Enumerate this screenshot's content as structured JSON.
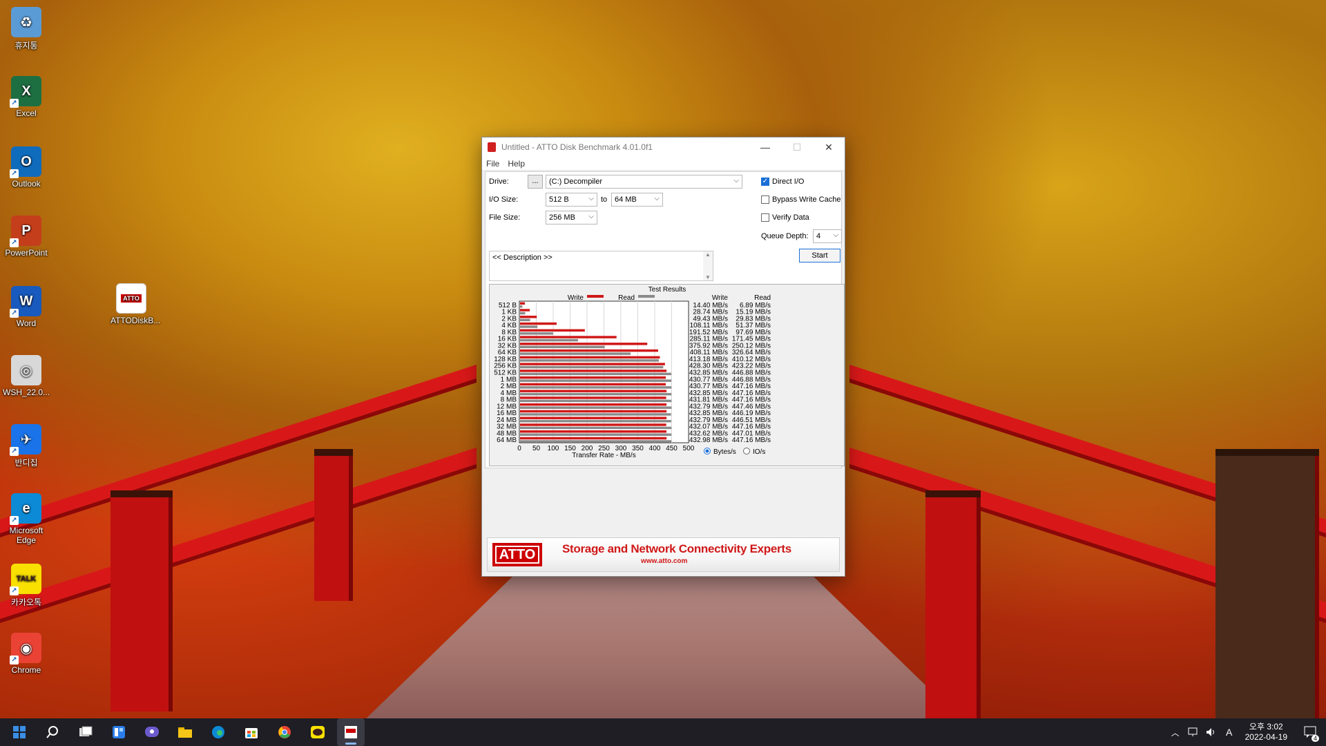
{
  "desktop": {
    "icons": [
      {
        "label": "휴지통",
        "color": "#5b9bd5",
        "glyph": "♻"
      },
      {
        "label": "Excel",
        "color": "#1d6f42",
        "glyph": "X"
      },
      {
        "label": "Outlook",
        "color": "#0f6cbd",
        "glyph": "O"
      },
      {
        "label": "PowerPoint",
        "color": "#c43e1c",
        "glyph": "P"
      },
      {
        "label": "Word",
        "color": "#185abd",
        "glyph": "W"
      },
      {
        "label": "WSH_22.0...",
        "color": "#d8d8d8",
        "glyph": "◎"
      },
      {
        "label": "반디집",
        "color": "#1a73e8",
        "glyph": "✈"
      },
      {
        "label": "Microsoft Edge",
        "color": "#0c8ad6",
        "glyph": "e"
      },
      {
        "label": "카카오톡",
        "color": "#f9e000",
        "glyph": "TALK"
      },
      {
        "label": "Chrome",
        "color": "#ea4335",
        "glyph": "◉"
      }
    ],
    "atto_icon": {
      "label": "ATTODiskB...",
      "badge": "ATTO"
    }
  },
  "window": {
    "title": "Untitled - ATTO Disk Benchmark 4.01.0f1",
    "menu": [
      "File",
      "Help"
    ],
    "drive_label": "Drive:",
    "browse_label": "...",
    "drive_value": "(C:) Decompiler",
    "io_size_label": "I/O Size:",
    "io_from": "512 B",
    "to_label": "to",
    "io_to": "64 MB",
    "file_size_label": "File Size:",
    "file_size": "256 MB",
    "direct_io": {
      "label": "Direct I/O",
      "checked": true
    },
    "bypass_cache": {
      "label": "Bypass Write Cache",
      "checked": false
    },
    "verify_data": {
      "label": "Verify Data",
      "checked": false
    },
    "queue_depth_label": "Queue Depth:",
    "queue_depth": "4",
    "start_label": "Start",
    "description": "<< Description >>",
    "units": {
      "bytes_label": "Bytes/s",
      "io_label": "IO/s",
      "selected": "bytes"
    },
    "banner": {
      "logo": "ATTO",
      "tagline": "Storage and Network Connectivity Experts",
      "url": "www.atto.com"
    }
  },
  "chart_data": {
    "type": "bar",
    "title": "Test Results",
    "xlabel": "Transfer Rate - MB/s",
    "xlim": [
      0,
      500
    ],
    "xticks": [
      0,
      50,
      100,
      150,
      200,
      250,
      300,
      350,
      400,
      450,
      500
    ],
    "categories": [
      "512 B",
      "1 KB",
      "2 KB",
      "4 KB",
      "8 KB",
      "16 KB",
      "32 KB",
      "64 KB",
      "128 KB",
      "256 KB",
      "512 KB",
      "1 MB",
      "2 MB",
      "4 MB",
      "8 MB",
      "12 MB",
      "16 MB",
      "24 MB",
      "32 MB",
      "48 MB",
      "64 MB"
    ],
    "series": [
      {
        "name": "Write",
        "color": "#d01818",
        "values": [
          14.4,
          28.74,
          49.43,
          108.11,
          191.52,
          285.11,
          375.92,
          408.11,
          413.18,
          428.3,
          432.85,
          430.77,
          430.77,
          432.85,
          431.81,
          432.79,
          432.85,
          432.79,
          432.07,
          432.62,
          432.98
        ],
        "labels": [
          "14.40 MB/s",
          "28.74 MB/s",
          "49.43 MB/s",
          "108.11 MB/s",
          "191.52 MB/s",
          "285.11 MB/s",
          "375.92 MB/s",
          "408.11 MB/s",
          "413.18 MB/s",
          "428.30 MB/s",
          "432.85 MB/s",
          "430.77 MB/s",
          "430.77 MB/s",
          "432.85 MB/s",
          "431.81 MB/s",
          "432.79 MB/s",
          "432.85 MB/s",
          "432.79 MB/s",
          "432.07 MB/s",
          "432.62 MB/s",
          "432.98 MB/s"
        ]
      },
      {
        "name": "Read",
        "color": "#8a8a8a",
        "values": [
          6.89,
          15.19,
          29.83,
          51.37,
          97.69,
          171.45,
          250.12,
          326.64,
          410.12,
          423.22,
          446.88,
          446.88,
          447.16,
          447.16,
          447.16,
          447.46,
          446.19,
          446.51,
          447.16,
          447.01,
          447.16
        ],
        "labels": [
          "6.89 MB/s",
          "15.19 MB/s",
          "29.83 MB/s",
          "51.37 MB/s",
          "97.69 MB/s",
          "171.45 MB/s",
          "250.12 MB/s",
          "326.64 MB/s",
          "410.12 MB/s",
          "423.22 MB/s",
          "446.88 MB/s",
          "446.88 MB/s",
          "447.16 MB/s",
          "447.16 MB/s",
          "447.16 MB/s",
          "447.46 MB/s",
          "446.19 MB/s",
          "446.51 MB/s",
          "447.16 MB/s",
          "447.01 MB/s",
          "447.16 MB/s"
        ]
      }
    ],
    "col_headers": {
      "write": "Write",
      "read": "Read"
    },
    "legend": "top"
  },
  "taskbar": {
    "items": [
      "start-icon",
      "search-icon",
      "task-view-icon",
      "widgets-icon",
      "chat-icon",
      "file-explorer-icon",
      "edge-icon",
      "store-icon",
      "chrome-icon",
      "kakaotalk-icon",
      "atto-icon"
    ],
    "time": "오후 3:02",
    "date": "2022-04-19",
    "ime": "A",
    "notification_count": "4"
  }
}
